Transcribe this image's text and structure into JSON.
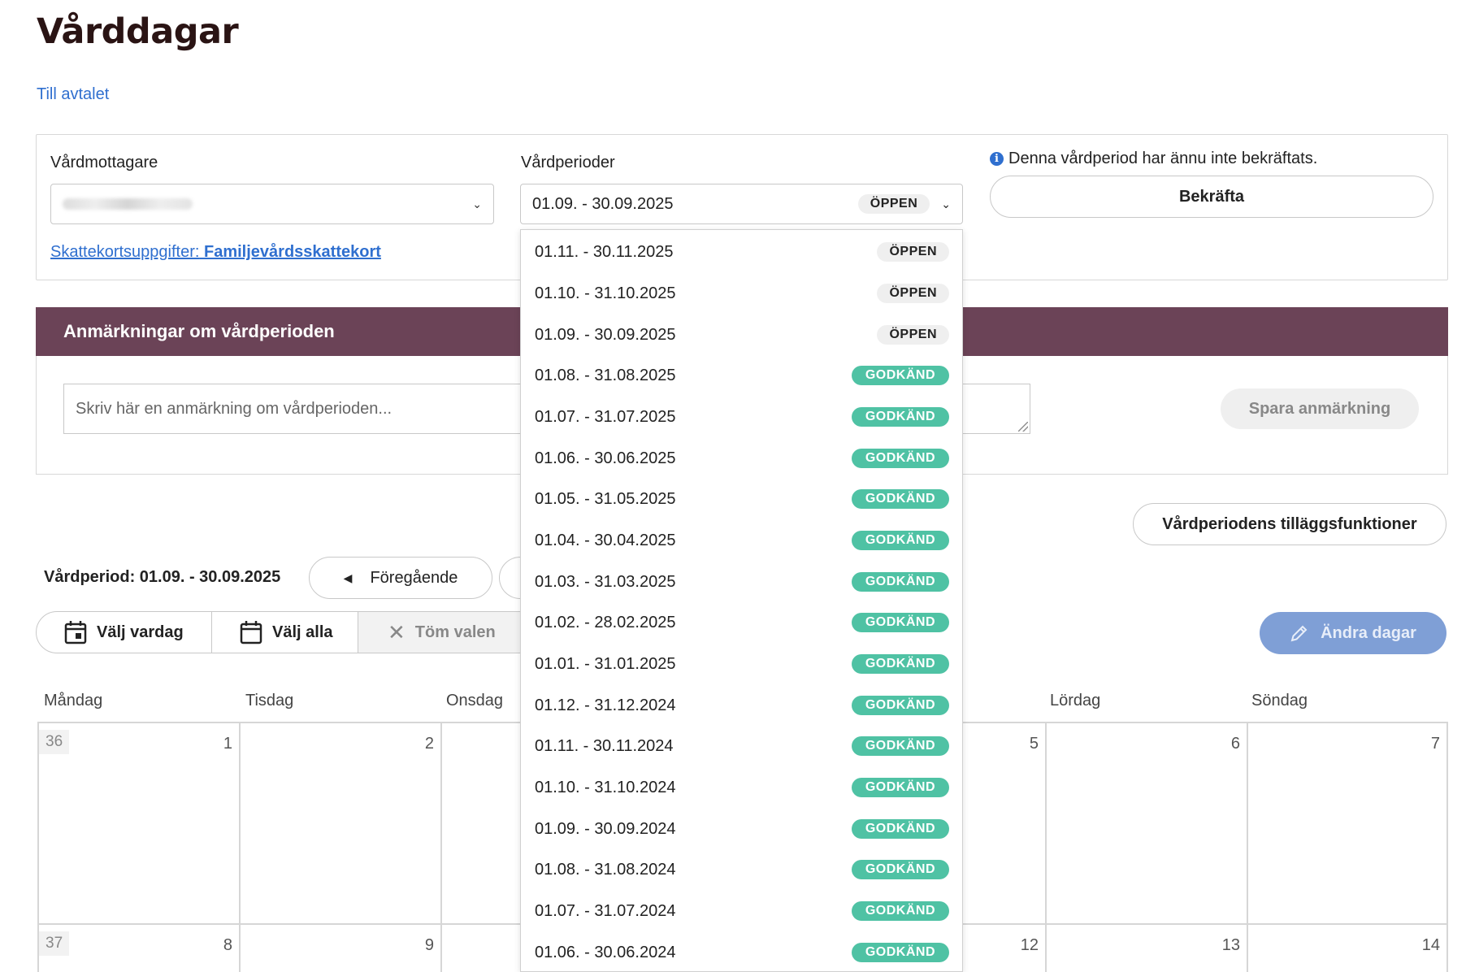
{
  "page": {
    "title": "Vårddagar",
    "back_link": "Till avtalet"
  },
  "recipient": {
    "label": "Vårdmottagare",
    "tax_link_prefix": "Skattekortsuppgifter:",
    "tax_link_value": "Familjevårdsskattekort"
  },
  "periods": {
    "label": "Vårdperioder",
    "selected": {
      "range": "01.09. - 30.09.2025",
      "status": "ÖPPEN"
    },
    "options": [
      {
        "range": "01.11. - 30.11.2025",
        "status": "ÖPPEN"
      },
      {
        "range": "01.10. - 31.10.2025",
        "status": "ÖPPEN"
      },
      {
        "range": "01.09. - 30.09.2025",
        "status": "ÖPPEN"
      },
      {
        "range": "01.08. - 31.08.2025",
        "status": "GODKÄND"
      },
      {
        "range": "01.07. - 31.07.2025",
        "status": "GODKÄND"
      },
      {
        "range": "01.06. - 30.06.2025",
        "status": "GODKÄND"
      },
      {
        "range": "01.05. - 31.05.2025",
        "status": "GODKÄND"
      },
      {
        "range": "01.04. - 30.04.2025",
        "status": "GODKÄND"
      },
      {
        "range": "01.03. - 31.03.2025",
        "status": "GODKÄND"
      },
      {
        "range": "01.02. - 28.02.2025",
        "status": "GODKÄND"
      },
      {
        "range": "01.01. - 31.01.2025",
        "status": "GODKÄND"
      },
      {
        "range": "01.12. - 31.12.2024",
        "status": "GODKÄND"
      },
      {
        "range": "01.11. - 30.11.2024",
        "status": "GODKÄND"
      },
      {
        "range": "01.10. - 31.10.2024",
        "status": "GODKÄND"
      },
      {
        "range": "01.09. - 30.09.2024",
        "status": "GODKÄND"
      },
      {
        "range": "01.08. - 31.08.2024",
        "status": "GODKÄND"
      },
      {
        "range": "01.07. - 31.07.2024",
        "status": "GODKÄND"
      },
      {
        "range": "01.06. - 30.06.2024",
        "status": "GODKÄND"
      }
    ]
  },
  "confirm": {
    "info": "Denna vårdperiod har ännu inte bekräftats.",
    "button": "Bekräfta"
  },
  "notes": {
    "heading": "Anmärkningar om vårdperioden",
    "placeholder": "Skriv här en anmärkning om vårdperioden...",
    "save_button": "Spara anmärkning"
  },
  "toolbar": {
    "extra_functions": "Vårdperiodens tilläggsfunktioner",
    "period_label": "Vårdperiod: 01.09. - 30.09.2025",
    "previous": "Föregående",
    "select_weekday": "Välj vardag",
    "select_all": "Välj alla",
    "clear": "Töm valen",
    "change_days": "Ändra dagar"
  },
  "calendar": {
    "weekdays": [
      "Måndag",
      "Tisdag",
      "Onsdag",
      "Lördag",
      "Söndag"
    ],
    "week1": {
      "week": "36",
      "days": [
        "1",
        "2",
        "5",
        "6",
        "7"
      ]
    },
    "week2": {
      "week": "37",
      "days": [
        "8",
        "9",
        "12",
        "13",
        "14"
      ]
    }
  },
  "colors": {
    "accent_link": "#2f6fcf",
    "notes_header": "#6b4357",
    "approved_badge": "#4fc2a4",
    "change_days_button": "#7f9fd6"
  }
}
